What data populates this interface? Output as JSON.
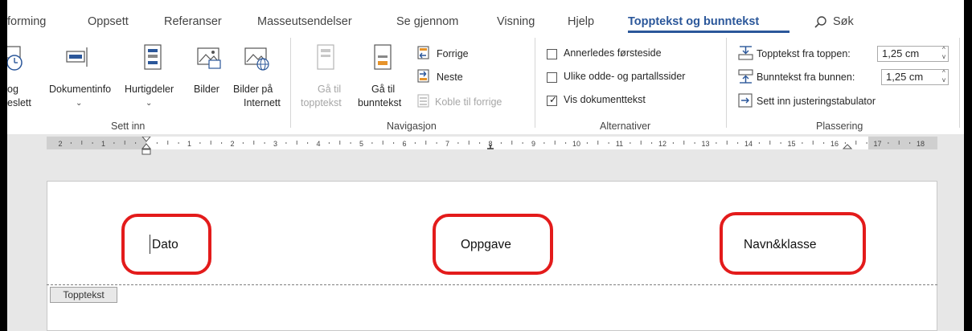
{
  "tabs": [
    "forming",
    "Oppsett",
    "Referanser",
    "Masseutsendelser",
    "Se gjennom",
    "Visning",
    "Hjelp",
    "Topptekst og bunntekst"
  ],
  "search": {
    "label": "Søk"
  },
  "groups": {
    "sett_inn": {
      "label": "Sett inn",
      "buttons": {
        "dato_line1": "og",
        "dato_line2": "eslett",
        "dokumentinfo": "Dokumentinfo",
        "hurtigdeler": "Hurtigdeler",
        "bilder": "Bilder",
        "bilder_internett_line1": "Bilder på",
        "bilder_internett_line2": "Internett"
      }
    },
    "navigasjon": {
      "label": "Navigasjon",
      "goto_header_line1": "Gå til",
      "goto_header_line2": "topptekst",
      "goto_footer_line1": "Gå til",
      "goto_footer_line2": "bunntekst",
      "previous": "Forrige",
      "next": "Neste",
      "link_previous": "Koble til forrige"
    },
    "alternativer": {
      "label": "Alternativer",
      "options": [
        {
          "label": "Annerledes førsteside",
          "checked": false
        },
        {
          "label": "Ulike odde- og partallssider",
          "checked": false
        },
        {
          "label": "Vis dokumenttekst",
          "checked": true
        }
      ]
    },
    "plassering": {
      "label": "Plassering",
      "header_from_top_label": "Topptekst fra toppen:",
      "header_from_top_value": "1,25 cm",
      "footer_from_bottom_label": "Bunntekst fra bunnen:",
      "footer_from_bottom_value": "1,25 cm",
      "insert_tab": "Sett inn justeringstabulator"
    }
  },
  "ruler": {
    "left_numbers": [
      "2",
      "1"
    ],
    "right_numbers": [
      "1",
      "2",
      "3",
      "4",
      "5",
      "6",
      "7",
      "8",
      "9",
      "10",
      "11",
      "12",
      "13",
      "14",
      "15",
      "16",
      "17",
      "18"
    ]
  },
  "document": {
    "header_items": [
      "Dato",
      "Oppgave",
      "Navn&klasse"
    ],
    "header_tag": "Topptekst"
  },
  "colors": {
    "accent": "#2b579a",
    "callout": "#e31b1b"
  }
}
